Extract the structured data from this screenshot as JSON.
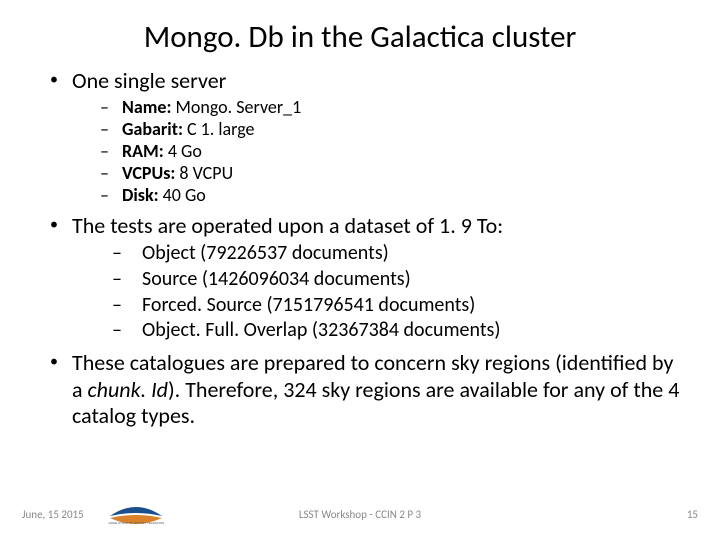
{
  "title": "Mongo. Db in the Galactica cluster",
  "bullets": {
    "b1": "One single server",
    "b1_sub": [
      {
        "label": "Name:",
        "value": " Mongo. Server_1"
      },
      {
        "label": "Gabarit:",
        "value": " C 1. large"
      },
      {
        "label": "RAM:",
        "value": " 4 Go"
      },
      {
        "label": "VCPUs:",
        "value": " 8 VCPU"
      },
      {
        "label": "Disk:",
        "value": " 40 Go"
      }
    ],
    "b2": "The tests are operated upon a dataset of 1. 9 To:",
    "b2_sub": [
      "Object (79226537 documents)",
      "Source (1426096034 documents)",
      "Forced. Source (7151796541 documents)",
      "Object. Full. Overlap (32367384 documents)"
    ],
    "b3_pre": "These catalogues are prepared to concern sky regions (identified by a ",
    "b3_em": "chunk. Id",
    "b3_post": "). Therefore, 324 sky regions are available for any of the 4 catalog types."
  },
  "footer": {
    "date": "June, 15 2015",
    "center": "LSST Workshop - CCIN 2 P 3",
    "page": "15"
  }
}
